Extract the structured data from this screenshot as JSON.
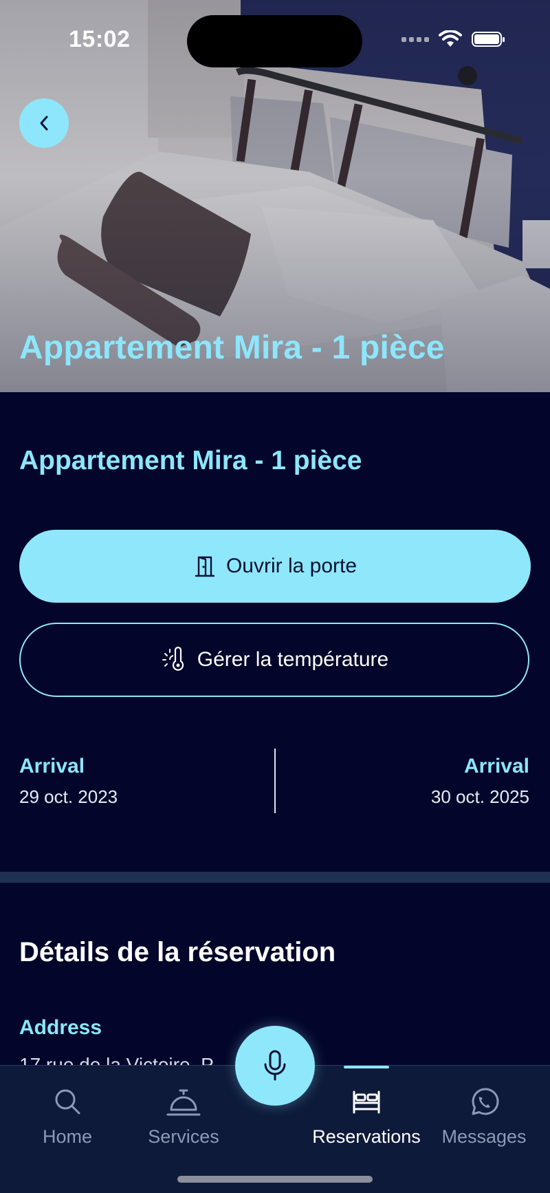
{
  "status_bar": {
    "time": "15:02"
  },
  "hero": {
    "title": "Appartement Mira - 1 pièce"
  },
  "main": {
    "title": "Appartement Mira - 1 pièce",
    "open_door_label": "Ouvrir la porte",
    "temperature_label": "Gérer la température",
    "dates": [
      {
        "label": "Arrival",
        "value": "29 oct. 2023"
      },
      {
        "label": "Arrival",
        "value": "30 oct. 2025"
      }
    ]
  },
  "details": {
    "title": "Détails de la réservation",
    "address_label": "Address",
    "address_value": "17 rue de la Victoire, P"
  },
  "tabbar": {
    "items": [
      {
        "label": "Home",
        "icon": "search-icon",
        "active": false
      },
      {
        "label": "Services",
        "icon": "concierge-bell-icon",
        "active": false
      },
      {
        "label": "Reservations",
        "icon": "bed-icon",
        "active": true
      },
      {
        "label": "Messages",
        "icon": "whatsapp-icon",
        "active": false
      }
    ],
    "center_icon": "microphone-icon"
  },
  "colors": {
    "background": "#03062a",
    "accent": "#8de6fb",
    "tabbar": "#0e1a3a",
    "band": "#1f3152"
  }
}
